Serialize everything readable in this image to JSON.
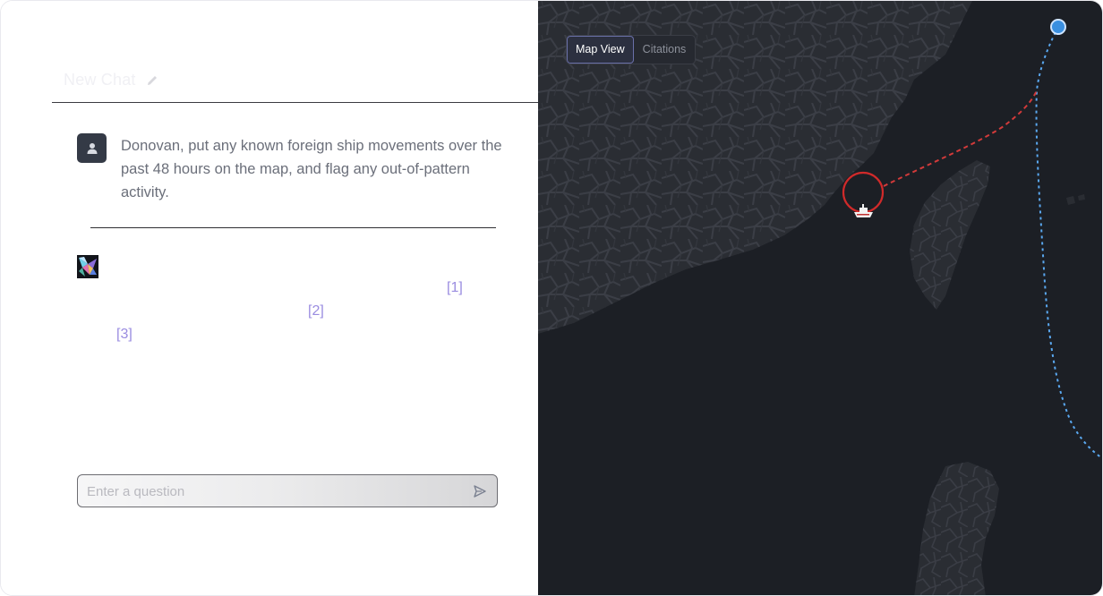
{
  "chat": {
    "title": "New Chat",
    "user_message": "Donovan, put any known foreign ship movements over the past 48 hours on the map, and flag any out-of-pattern activity.",
    "citations": [
      "[1]",
      "[2]",
      "[3]"
    ],
    "input_placeholder": "Enter a question"
  },
  "map": {
    "tabs": [
      {
        "label": "Map View",
        "active": true
      },
      {
        "label": "Citations",
        "active": false
      }
    ],
    "colors": {
      "background": "#1c1f25",
      "land": "#2a2d33",
      "roads": "#3d4048",
      "alert_track": "#d23a3a",
      "normal_track": "#5aa8f0"
    },
    "icons": {
      "ship": "ship-icon",
      "alert_ring": "alert-circle",
      "origin_marker": "location-dot"
    }
  }
}
